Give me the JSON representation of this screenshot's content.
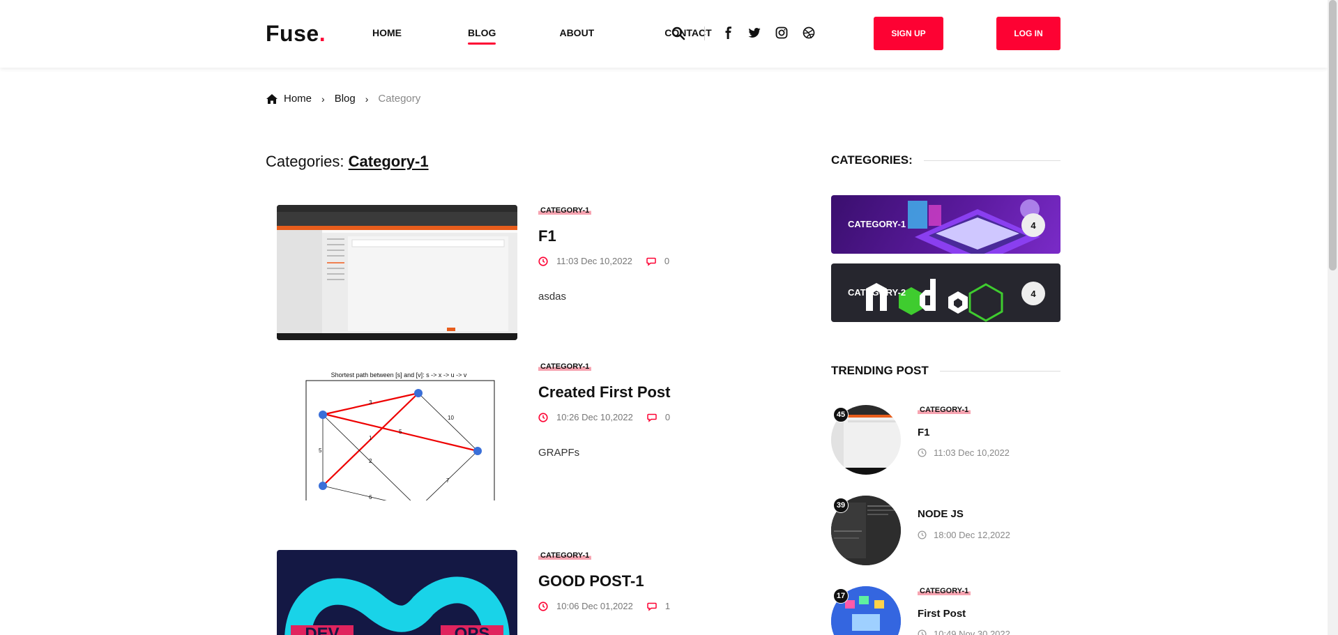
{
  "brand": {
    "name": "Fuse",
    "dot": ".",
    "accent": "#fd0233"
  },
  "nav": {
    "home": "HOME",
    "blog": "BLOG",
    "about": "ABOUT",
    "contact": "CONTACT",
    "active": "BLOG"
  },
  "header_icons": [
    "search-icon",
    "facebook-icon",
    "twitter-icon",
    "instagram-icon",
    "dribbble-icon"
  ],
  "buttons": {
    "signup": "SIGN UP",
    "login": "LOG IN"
  },
  "breadcrumb": {
    "home": "Home",
    "blog": "Blog",
    "current": "Category"
  },
  "page_title": {
    "prefix": "Categories:",
    "category": "Category-1"
  },
  "posts": [
    {
      "tag": "CATEGORY-1",
      "title": "F1",
      "time": "11:03 Dec 10,2022",
      "comments": "0",
      "excerpt": "asdas"
    },
    {
      "tag": "CATEGORY-1",
      "title": "Created First Post",
      "time": "10:26 Dec 10,2022",
      "comments": "0",
      "excerpt": "GRAPFs",
      "image_caption": "Shortest path between [s] and [v]: s -> x -> u -> v"
    },
    {
      "tag": "CATEGORY-1",
      "title": "GOOD POST-1",
      "time": "10:06 Dec 01,2022",
      "comments": "1",
      "image_text": [
        "DEV",
        "OPS"
      ]
    }
  ],
  "sidebar": {
    "categories_heading": "CATEGORIES:",
    "categories": [
      {
        "label": "CATEGORY-1",
        "count": "4"
      },
      {
        "label": "CATEGORY-2",
        "count": "4"
      }
    ],
    "trending_heading": "TRENDING POST",
    "trending": [
      {
        "count": "45",
        "tag": "CATEGORY-1",
        "title": "F1",
        "time": "11:03 Dec 10,2022"
      },
      {
        "count": "39",
        "tag": "",
        "title": "NODE JS",
        "time": "18:00 Dec 12,2022"
      },
      {
        "count": "17",
        "tag": "CATEGORY-1",
        "title": "First Post",
        "time": "10:49 Nov 30,2022"
      }
    ]
  }
}
